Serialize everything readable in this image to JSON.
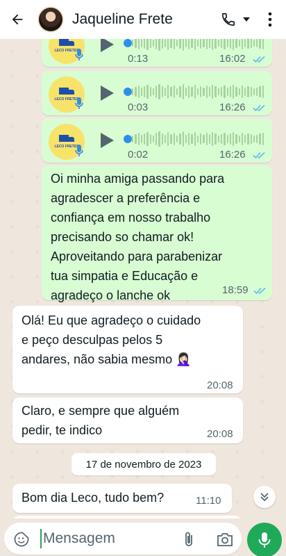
{
  "header": {
    "contact_name": "Jaqueline Frete",
    "icons": [
      "back-arrow-icon",
      "phone-icon",
      "dropdown-icon",
      "more-vert-icon"
    ]
  },
  "messages": [
    {
      "type": "voice",
      "direction": "out",
      "thumb_brand": "LECO FRETES",
      "duration": "0:13",
      "time": "16:02",
      "status": "read"
    },
    {
      "type": "voice",
      "direction": "out",
      "thumb_brand": "LECO FRETES",
      "duration": "0:03",
      "time": "16:26",
      "status": "read"
    },
    {
      "type": "voice",
      "direction": "out",
      "thumb_brand": "LECO FRETES",
      "duration": "0:02",
      "time": "16:26",
      "status": "read"
    },
    {
      "type": "text",
      "direction": "out",
      "lines": [
        "Oi minha amiga passando para",
        "agradescer a preferência e",
        "confiança em nosso trabalho",
        "precisando so chamar ok!",
        "Aproveitando para parabenizar",
        "tua simpatia e Educação e",
        "agradeço o lanche ok"
      ],
      "time": "18:59",
      "status": "read"
    },
    {
      "type": "text",
      "direction": "in",
      "lines": [
        "Olá! Eu que agradeço o cuidado",
        "e peço desculpas pelos 5",
        "andares,  não sabia mesmo 🤦🏻‍♀️"
      ],
      "time": "20:08"
    },
    {
      "type": "text",
      "direction": "in",
      "lines": [
        "Claro, e sempre que alguém",
        "pedir, te indico"
      ],
      "time": "20:08"
    },
    {
      "type": "text",
      "direction": "in",
      "lines": [
        "Bom dia Leco, tudo bem?"
      ],
      "time": "11:10"
    }
  ],
  "date_separator": "17 de novembro de 2023",
  "composer": {
    "placeholder": "Mensagem"
  },
  "colors": {
    "outgoing": "#d9fdd3",
    "incoming": "#ffffff",
    "accent": "#1faa59",
    "read_ticks": "#53bdeb"
  }
}
